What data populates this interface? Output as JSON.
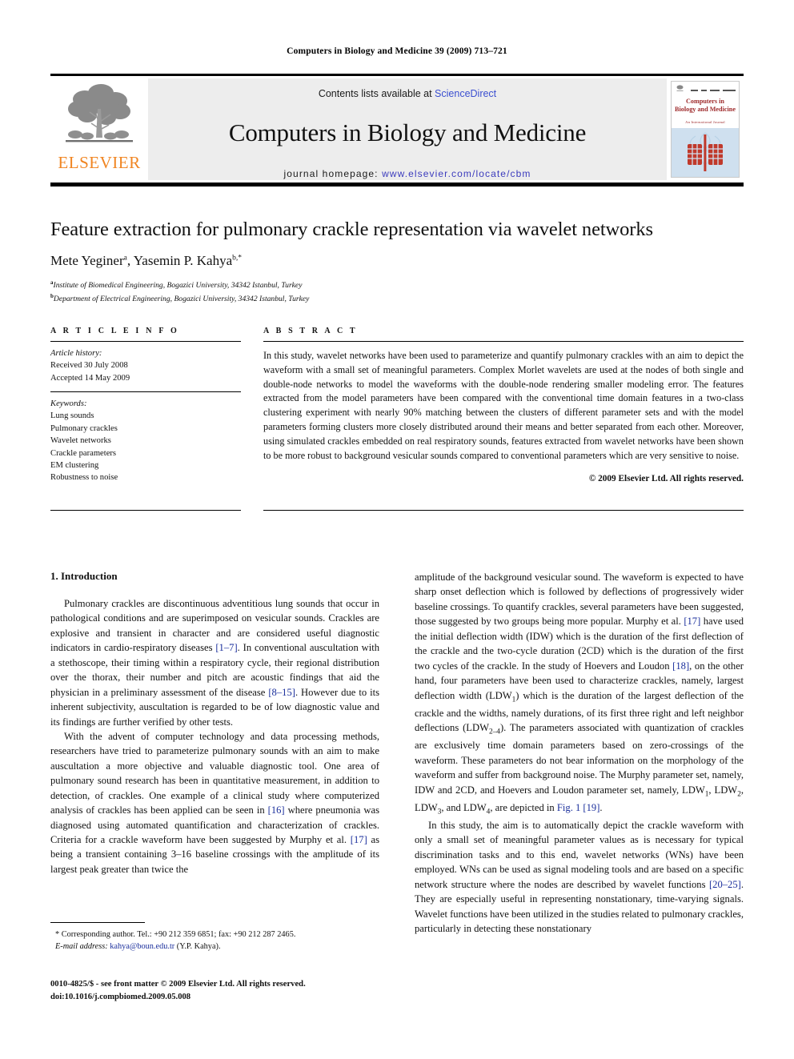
{
  "running_head": "Computers in Biology and Medicine 39 (2009) 713–721",
  "masthead": {
    "publisher_wordmark": "ELSEVIER",
    "contents_prefix": "Contents lists available at ",
    "contents_link": "ScienceDirect",
    "journal_title": "Computers in Biology and Medicine",
    "homepage_prefix": "journal homepage: ",
    "homepage_url": "www.elsevier.com/locate/cbm",
    "cover": {
      "title": "Computers in Biology and Medicine",
      "subtitle": "An International Journal"
    }
  },
  "article": {
    "title": "Feature extraction for pulmonary crackle representation via wavelet networks",
    "authors": "Mete Yeginer, Yasemin P. Kahya",
    "author_marks": {
      "first": "a",
      "second": "b,*"
    },
    "affiliations": [
      {
        "mark": "a",
        "text": "Institute of Biomedical Engineering, Bogazici University, 34342 Istanbul, Turkey"
      },
      {
        "mark": "b",
        "text": "Department of Electrical Engineering, Bogazici University, 34342 Istanbul, Turkey"
      }
    ]
  },
  "info": {
    "heading": "A R T I C L E   I N F O",
    "history_label": "Article history:",
    "history": [
      "Received 30 July 2008",
      "Accepted 14 May 2009"
    ],
    "keywords_label": "Keywords:",
    "keywords": [
      "Lung sounds",
      "Pulmonary crackles",
      "Wavelet networks",
      "Crackle parameters",
      "EM clustering",
      "Robustness to noise"
    ]
  },
  "abstract": {
    "heading": "A B S T R A C T",
    "text": "In this study, wavelet networks have been used to parameterize and quantify pulmonary crackles with an aim to depict the waveform with a small set of meaningful parameters. Complex Morlet wavelets are used at the nodes of both single and double-node networks to model the waveforms with the double-node rendering smaller modeling error. The features extracted from the model parameters have been compared with the conventional time domain features in a two-class clustering experiment with nearly 90% matching between the clusters of different parameter sets and with the model parameters forming clusters more closely distributed around their means and better separated from each other. Moreover, using simulated crackles embedded on real respiratory sounds, features extracted from wavelet networks have been shown to be more robust to background vesicular sounds compared to conventional parameters which are very sensitive to noise.",
    "copyright": "© 2009 Elsevier Ltd. All rights reserved."
  },
  "body": {
    "section_number_title": "1. Introduction",
    "left_paragraphs": [
      {
        "parts": [
          {
            "t": "Pulmonary crackles are discontinuous adventitious lung sounds that occur in pathological conditions and are superimposed on vesicular sounds. Crackles are explosive and transient in character and are considered useful diagnostic indicators in cardio-respiratory diseases "
          },
          {
            "t": "[1–7]",
            "ref": true
          },
          {
            "t": ". In conventional auscultation with a stethoscope, their timing within a respiratory cycle, their regional distribution over the thorax, their number and pitch are acoustic findings that aid the physician in a preliminary assessment of the disease "
          },
          {
            "t": "[8–15]",
            "ref": true
          },
          {
            "t": ". However due to its inherent subjectivity, auscultation is regarded to be of low diagnostic value and its findings are further verified by other tests."
          }
        ]
      },
      {
        "parts": [
          {
            "t": "With the advent of computer technology and data processing methods, researchers have tried to parameterize pulmonary sounds with an aim to make auscultation a more objective and valuable diagnostic tool. One area of pulmonary sound research has been in quantitative measurement, in addition to detection, of crackles. One example of a clinical study where computerized analysis of crackles has been applied can be seen in "
          },
          {
            "t": "[16]",
            "ref": true
          },
          {
            "t": " where pneumonia was diagnosed using automated quantification and characterization of crackles. Criteria for a crackle waveform have been suggested by Murphy et al. "
          },
          {
            "t": "[17]",
            "ref": true
          },
          {
            "t": " as being a transient containing 3–16 baseline crossings with the amplitude of its largest peak greater than twice the"
          }
        ]
      }
    ],
    "right_paragraphs": [
      {
        "parts": [
          {
            "t": "amplitude of the background vesicular sound. The waveform is expected to have sharp onset deflection which is followed by deflections of progressively wider baseline crossings. To quantify crackles, several parameters have been suggested, those suggested by two groups being more popular. Murphy et al. "
          },
          {
            "t": "[17]",
            "ref": true
          },
          {
            "t": " have used the initial deflection width (IDW) which is the duration of the first deflection of the crackle and the two-cycle duration (2CD) which is the duration of the first two cycles of the crackle. In the study of Hoevers and Loudon "
          },
          {
            "t": "[18]",
            "ref": true
          },
          {
            "t": ", on the other hand, four parameters have been used to characterize crackles, namely, largest deflection width (LDW"
          },
          {
            "t": "1",
            "sub": true
          },
          {
            "t": ") which is the duration of the largest deflection of the crackle and the widths, namely durations, of its first three right and left neighbor deflections (LDW"
          },
          {
            "t": "2–4",
            "sub": true
          },
          {
            "t": "). The parameters associated with quantization of crackles are exclusively time domain parameters based on zero-crossings of the waveform. These parameters do not bear information on the morphology of the waveform and suffer from background noise. The Murphy parameter set, namely, IDW and 2CD, and Hoevers and Loudon parameter set, namely, LDW"
          },
          {
            "t": "1",
            "sub": true
          },
          {
            "t": ", LDW"
          },
          {
            "t": "2",
            "sub": true
          },
          {
            "t": ", LDW"
          },
          {
            "t": "3",
            "sub": true
          },
          {
            "t": ", and LDW"
          },
          {
            "t": "4",
            "sub": true
          },
          {
            "t": ", are depicted in "
          },
          {
            "t": "Fig. 1 [19]",
            "ref": true
          },
          {
            "t": "."
          }
        ]
      },
      {
        "parts": [
          {
            "t": "In this study, the aim is to automatically depict the crackle waveform with only a small set of meaningful parameter values as is necessary for typical discrimination tasks and to this end, wavelet networks (WNs) have been employed. WNs can be used as signal modeling tools and are based on a specific network structure where the nodes are described by wavelet functions "
          },
          {
            "t": "[20–25]",
            "ref": true
          },
          {
            "t": ". They are especially useful in representing nonstationary, time-varying signals. Wavelet functions have been utilized in the studies related to pulmonary crackles, particularly in detecting these nonstationary"
          }
        ]
      }
    ]
  },
  "footnote": {
    "corresponding": "* Corresponding author. Tel.: +90 212 359 6851; fax: +90 212 287 2465.",
    "email_label": "E-mail address:",
    "email": "kahya@boun.edu.tr",
    "email_suffix": " (Y.P. Kahya)."
  },
  "imprint": {
    "line1": "0010-4825/$ - see front matter © 2009 Elsevier Ltd. All rights reserved.",
    "line2": "doi:10.1016/j.compbiomed.2009.05.008"
  }
}
